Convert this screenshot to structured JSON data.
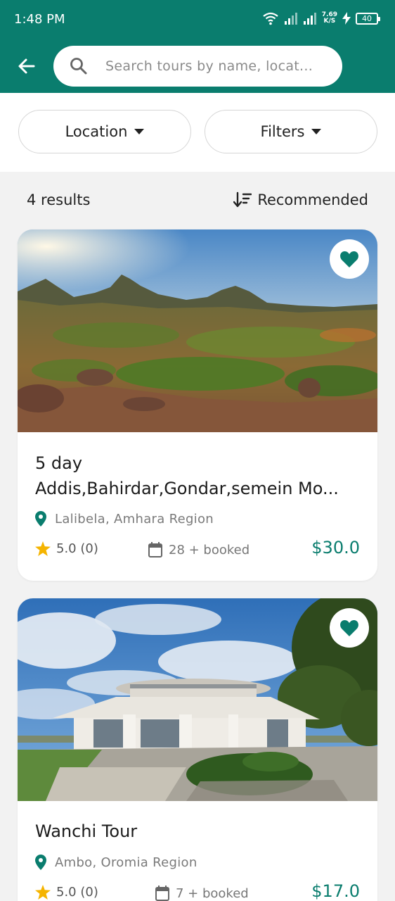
{
  "status_bar": {
    "time": "1:48 PM",
    "net_speed_value": "7.69",
    "net_speed_unit": "K/S",
    "battery": "40"
  },
  "header": {
    "back_icon": "arrow-left-icon",
    "search": {
      "placeholder": "Search tours by name, locat...",
      "value": ""
    }
  },
  "filters": {
    "location_label": "Location",
    "filters_label": "Filters"
  },
  "results": {
    "count_text": "4 results",
    "sort_label": "Recommended"
  },
  "tours": [
    {
      "title_line1": "5 day",
      "title_line2": "Addis,Bahirdar,Gondar,semein Mo...",
      "location": "Lalibela, Amhara Region",
      "rating": "5.0 (0)",
      "booked": "28 + booked",
      "price": "$30.0",
      "favorite": true
    },
    {
      "title_line1": "Wanchi Tour",
      "location": "Ambo, Oromia Region",
      "rating": "5.0 (0)",
      "booked": "7 + booked",
      "price": "$17.0",
      "favorite": true
    }
  ],
  "colors": {
    "primary": "#0a7d6e",
    "star": "#f5b400"
  }
}
